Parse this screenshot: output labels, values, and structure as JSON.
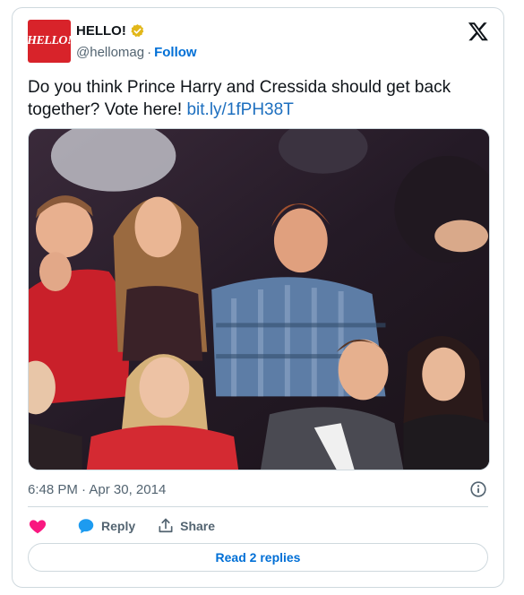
{
  "account": {
    "avatar_text": "HELLO!",
    "display_name": "HELLO!",
    "handle": "@hellomag",
    "separator": "·",
    "follow_label": "Follow",
    "verified_color": "#e2b719"
  },
  "tweet": {
    "text_before_link": "Do you think Prince Harry and Cressida should get back together? Vote here! ",
    "link_text": "bit.ly/1fPH38T"
  },
  "meta": {
    "time": "6:48 PM",
    "date_separator": "·",
    "date": "Apr 30, 2014"
  },
  "actions": {
    "like_icon": "heart-icon",
    "reply_label": "Reply",
    "share_label": "Share",
    "read_replies_label": "Read 2 replies"
  },
  "colors": {
    "accent": "#006fd6",
    "like": "#f91880",
    "reply_icon": "#1d9bf0",
    "brand_red": "#d8232a"
  }
}
